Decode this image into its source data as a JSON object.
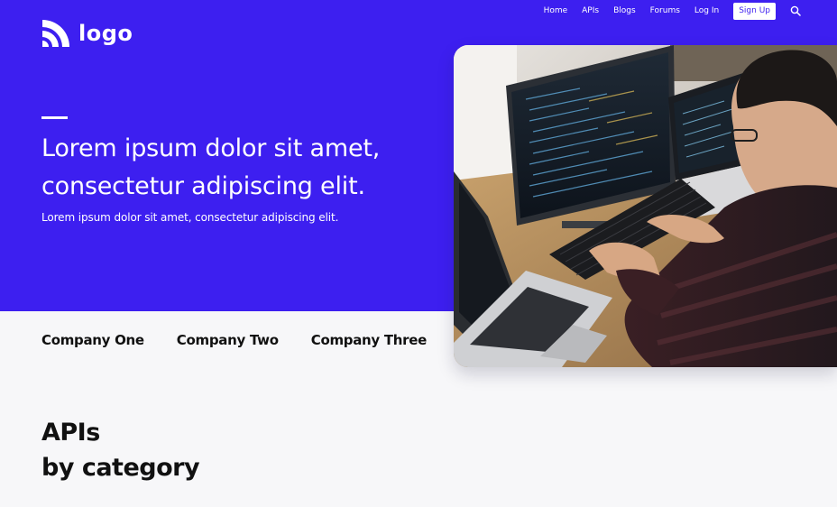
{
  "brand": {
    "logo_text": "logo"
  },
  "nav": {
    "links": [
      "Home",
      "APIs",
      "Blogs",
      "Forums",
      "Log In"
    ],
    "signup_label": "Sign Up",
    "search_icon": "search-icon"
  },
  "hero": {
    "title_line1": "Lorem ipsum dolor sit amet,",
    "title_line2": "consectetur adipiscing elit.",
    "subtitle": "Lorem ipsum dolor sit amet, consectetur adipiscing elit.",
    "photo_icon": "developer-photo"
  },
  "companies": [
    "Company One",
    "Company Two",
    "Company Three"
  ],
  "section": {
    "title_line1": "APIs",
    "title_line2": "by category"
  },
  "colors": {
    "accent": "#3d1ff0",
    "background": "#f7f7f9",
    "text": "#111111"
  }
}
